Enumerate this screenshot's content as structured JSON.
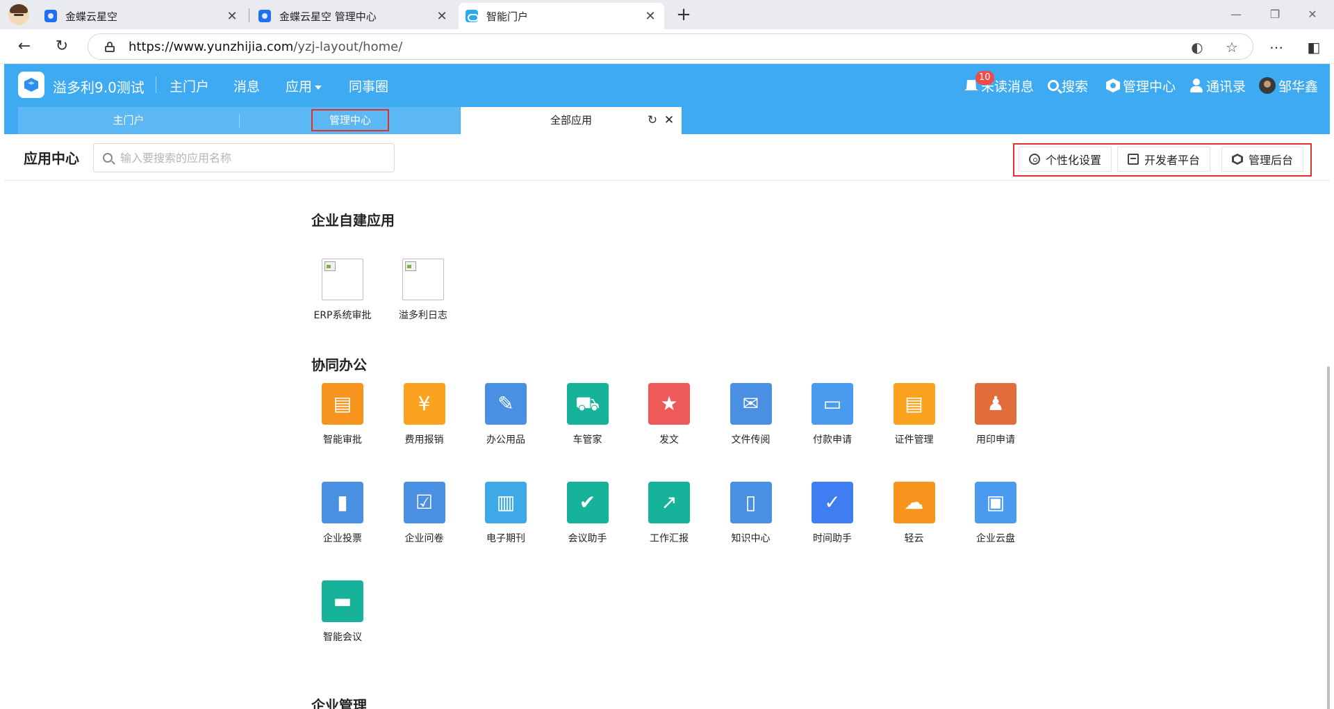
{
  "browser": {
    "tabs": [
      {
        "title": "金蝶云星空",
        "icon": "kingdee-icon"
      },
      {
        "title": "金蝶云星空 管理中心",
        "icon": "kingdee-icon"
      },
      {
        "title": "智能门户",
        "icon": "cloud-icon"
      }
    ],
    "url_host": "https://www.yunzhijia.com",
    "url_path": "/yzj-layout/home/"
  },
  "header": {
    "company": "溢多利9.0测试",
    "nav": [
      "主门户",
      "消息",
      "应用",
      "同事圈"
    ],
    "unread_count": "10",
    "tools": {
      "unread": "未读消息",
      "search": "搜索",
      "admin": "管理中心",
      "contacts": "通讯录",
      "user": "邹华鑫"
    }
  },
  "subtabs": {
    "home": "主门户",
    "admin": "管理中心",
    "all_apps": "全部应用"
  },
  "toolbar": {
    "title": "应用中心",
    "search_placeholder": "输入要搜索的应用名称",
    "personalize": "个性化设置",
    "developer": "开发者平台",
    "backend": "管理后台"
  },
  "sections": {
    "custom": {
      "title": "企业自建应用",
      "apps": [
        {
          "name": "ERP系统审批"
        },
        {
          "name": "溢多利日志"
        }
      ]
    },
    "collab": {
      "title": "协同办公",
      "apps": [
        {
          "name": "智能审批",
          "color": "#f7941d"
        },
        {
          "name": "费用报销",
          "color": "#fba21f"
        },
        {
          "name": "办公用品",
          "color": "#4a90e2"
        },
        {
          "name": "车管家",
          "color": "#16b39a"
        },
        {
          "name": "发文",
          "color": "#ee5a5a"
        },
        {
          "name": "文件传阅",
          "color": "#4a90e2"
        },
        {
          "name": "付款申请",
          "color": "#4a9bef"
        },
        {
          "name": "证件管理",
          "color": "#fba21f"
        },
        {
          "name": "用印申请",
          "color": "#e36d3a"
        },
        {
          "name": "企业投票",
          "color": "#4a90e2"
        },
        {
          "name": "企业问卷",
          "color": "#4a90e2"
        },
        {
          "name": "电子期刊",
          "color": "#3fa9e8"
        },
        {
          "name": "会议助手",
          "color": "#16b39a"
        },
        {
          "name": "工作汇报",
          "color": "#16b39a"
        },
        {
          "name": "知识中心",
          "color": "#4a90e2"
        },
        {
          "name": "时间助手",
          "color": "#3f7ef0"
        },
        {
          "name": "轻云",
          "color": "#f7941d"
        },
        {
          "name": "企业云盘",
          "color": "#4a9bef"
        },
        {
          "name": "智能会议",
          "color": "#16b39a"
        }
      ]
    },
    "next_partial": "企业管理"
  }
}
